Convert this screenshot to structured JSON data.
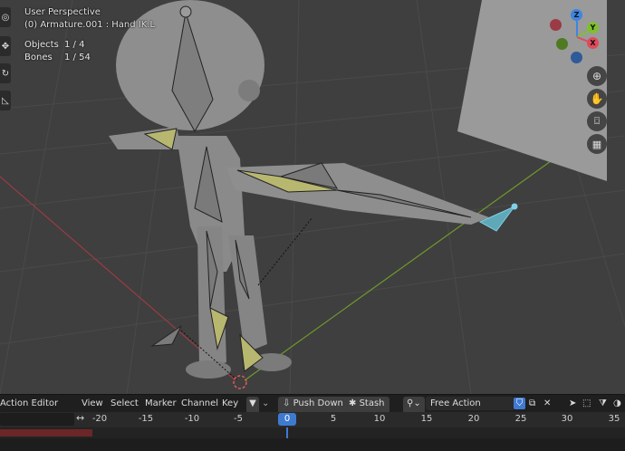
{
  "viewport": {
    "title": "User Perspective",
    "active": "(0) Armature.001 : Hand IK.L",
    "stats": [
      {
        "label": "Objects",
        "value": "1 / 4"
      },
      {
        "label": "Bones",
        "value": "1 / 54"
      }
    ],
    "gizmo": {
      "z": "Z",
      "y": "Y",
      "x": "X"
    },
    "colors": {
      "x_axis": "#e04a5a",
      "y_axis": "#7fbf2e",
      "z_axis": "#3f84e0",
      "selected_bone": "#7fd0e6",
      "bone_fill_yellow": "#b8b770"
    }
  },
  "action_editor": {
    "mode": "Action Editor",
    "menus": [
      "View",
      "Select",
      "Marker",
      "Channel",
      "Key"
    ],
    "push_down": "Push Down",
    "stash": "Stash",
    "action_name": "Free Action"
  },
  "timeline": {
    "current_frame": "0",
    "frames": [
      "-20",
      "-15",
      "-10",
      "-5",
      "5",
      "10",
      "15",
      "20",
      "25",
      "30",
      "35"
    ]
  }
}
